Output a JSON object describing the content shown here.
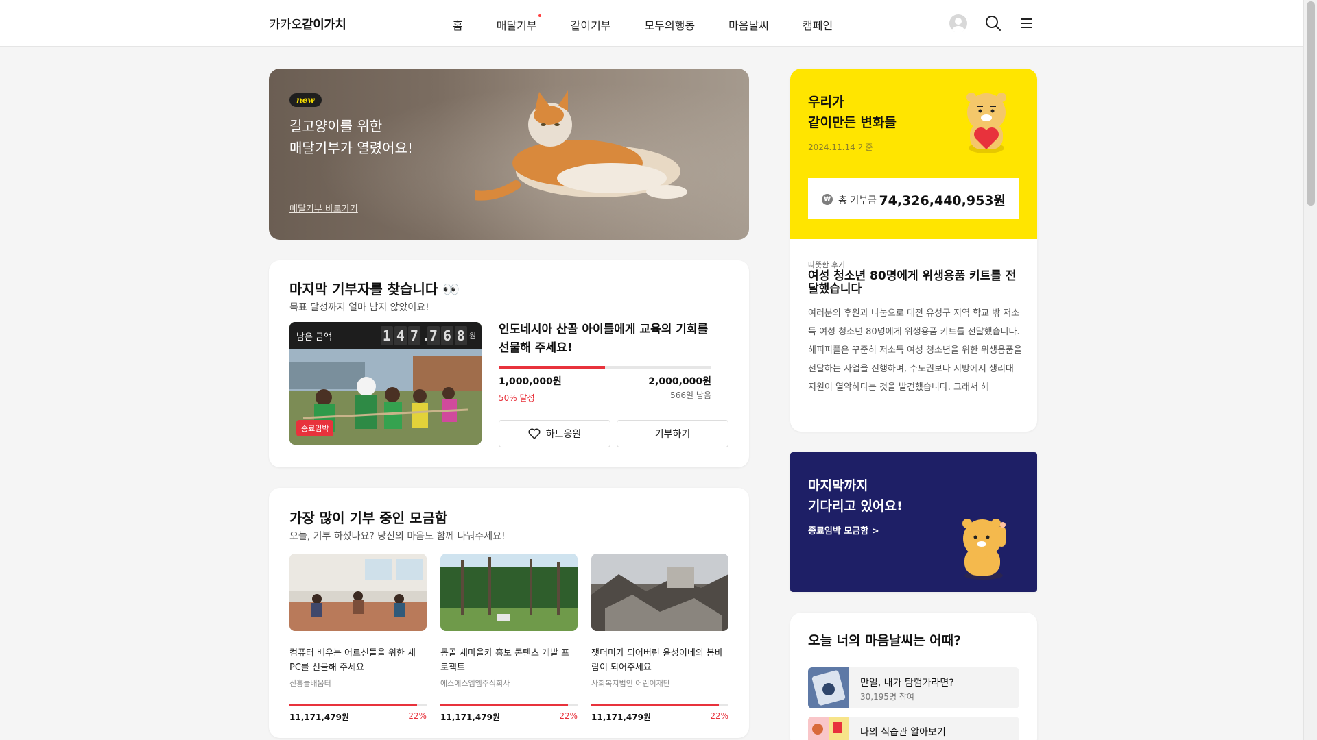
{
  "header": {
    "logo_prefix": "카카오",
    "logo_brand": "같이가치",
    "nav": [
      {
        "label": "홈",
        "dot": false
      },
      {
        "label": "매달기부",
        "dot": true
      },
      {
        "label": "같이기부",
        "dot": false
      },
      {
        "label": "모두의행동",
        "dot": false
      },
      {
        "label": "마음날씨",
        "dot": false
      },
      {
        "label": "캠페인",
        "dot": false
      }
    ],
    "icons": [
      "avatar",
      "search-icon",
      "menu-icon"
    ]
  },
  "hero": {
    "badge": "new",
    "title_line1": "길고양이를 위한",
    "title_line2": "매달기부가 열렸어요!",
    "link": "매달기부 바로가기"
  },
  "last_donor": {
    "title": "마지막 기부자를 찾습니다 👀",
    "subtitle": "목표 달성까지 얼마 남지 않았어요!",
    "remaining_label": "남은 금액",
    "remaining_digits": [
      "1",
      "4",
      "7",
      ".",
      "7",
      "6",
      "8"
    ],
    "remaining_unit": "원",
    "urgent_badge": "종료임박",
    "project_title": "인도네시아 산골 아이들에게 교육의 기회를 선물해 주세요!",
    "raised": "1,000,000원",
    "goal": "2,000,000원",
    "progress": 0.5,
    "percent_label": "50% 달성",
    "days_left": "566일 남음",
    "heart_button": "하트응원",
    "donate_button": "기부하기"
  },
  "most_donated": {
    "title": "가장 많이 기부 중인 모금함",
    "subtitle": "오늘, 기부 하셨나요? 당신의 마음도 함께 나눠주세요!",
    "items": [
      {
        "title": "컴퓨터 배우는 어르신들을 위한 새 PC를 선물해 주세요",
        "org": "신흥늘배움터",
        "amount": "11,171,479원",
        "percent": "22%",
        "progress": 0.93
      },
      {
        "title": "몽골 새마을카 홍보 콘텐츠 개발 프로젝트",
        "org": "에스에스엠엠주식회사",
        "amount": "11,171,479원",
        "percent": "22%",
        "progress": 0.93
      },
      {
        "title": "잿더미가 되어버린 윤성이네의 봄바람이 되어주세요",
        "org": "사회복지법인 어린이재단",
        "amount": "11,171,479원",
        "percent": "22%",
        "progress": 0.93
      }
    ]
  },
  "summary": {
    "title_line1": "우리가",
    "title_line2": "같이만든 변화들",
    "date": "2024.11.14 기준",
    "total_icon": "₩",
    "total_label": "총 기부금",
    "total_value": "74,326,440,953원",
    "review_tag": "따뜻한 후기",
    "review_title": "여성 청소년 80명에게 위생용품 키트를 전달했습니다",
    "review_body": "여러분의 후원과 나눔으로 대전 유성구 지역 학교 밖 저소득 여성 청소년 80명에게 위생용품 키트를 전달했습니다. 해피피플은 꾸준히 저소득 여성 청소년을 위한 위생용품을 전달하는 사업을 진행하며, 수도권보다 지방에서 생리대 지원이 열악하다는 것을 발견했습니다. 그래서 해"
  },
  "navy_banner": {
    "title_line1": "마지막까지",
    "title_line2": "기다리고 있어요!",
    "link": "종료임박 모금함 >"
  },
  "mood": {
    "title": "오늘 너의 마음날씨는 어때?",
    "items": [
      {
        "name": "만일, 내가 탐험가라면?",
        "count": "30,195명 참여"
      },
      {
        "name": "나의 식습관 알아보기",
        "count": ""
      }
    ]
  },
  "colors": {
    "accent_red": "#e8323c",
    "kakao_yellow": "#ffe500",
    "navy": "#1e1f66"
  }
}
